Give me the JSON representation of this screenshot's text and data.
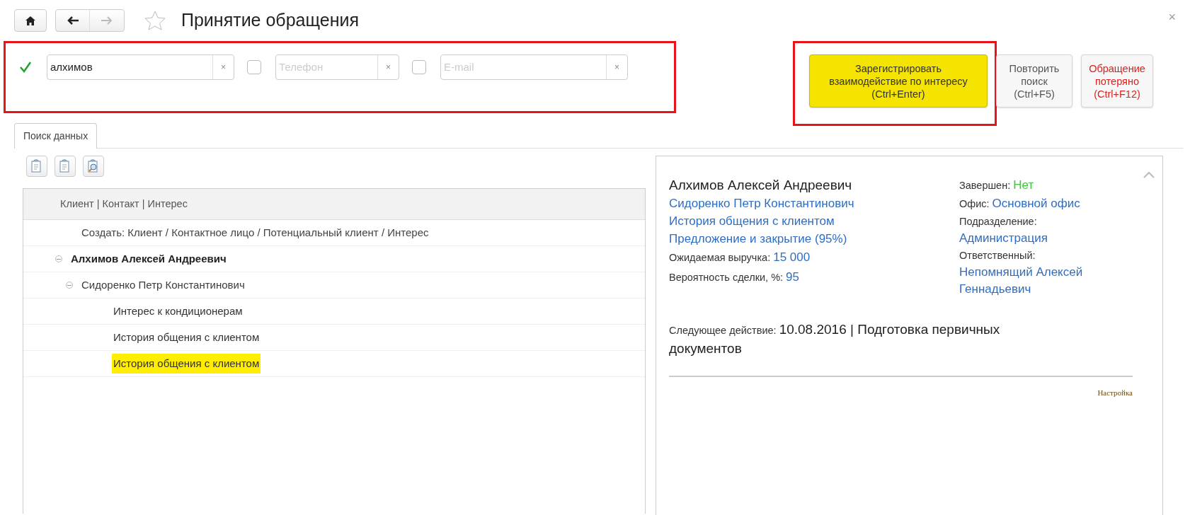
{
  "window": {
    "title": "Принятие обращения",
    "favorite": false
  },
  "filters": [
    {
      "checked": true,
      "value": "алхимов",
      "clear": "×"
    },
    {
      "checked": false,
      "placeholder": "Телефон",
      "clear": "×"
    },
    {
      "checked": false,
      "placeholder": "E-mail",
      "clear": "×"
    }
  ],
  "actions": [
    {
      "kind": "primary",
      "label": [
        "Зарегистрировать",
        "взаимодействие по интересу",
        "(Ctrl+Enter)"
      ]
    },
    {
      "kind": "default",
      "label": [
        "Повторить",
        "поиск",
        "(Ctrl+F5)"
      ]
    },
    {
      "kind": "danger",
      "label": [
        "Обращение",
        "потеряно",
        "(Ctrl+F12)"
      ]
    }
  ],
  "close": "×",
  "tabs": [
    {
      "label": "Поиск данных",
      "selected": true
    }
  ],
  "tree": {
    "header": "Клиент | Контакт | Интерес",
    "items": [
      {
        "kind": "action",
        "label": "Создать: Клиент / Контактное лицо / Потенциальный клиент / Интерес",
        "selected": false
      },
      {
        "kind": "client",
        "label": "Алхимов Алексей Андреевич",
        "selected": false,
        "expanded": true,
        "children": [
          {
            "kind": "contact",
            "label": "Сидоренко Петр Константинович",
            "selected": false,
            "expanded": true,
            "children": [
              {
                "kind": "interest",
                "label": "Интерес к кондиционерам",
                "selected": false
              },
              {
                "kind": "interest",
                "label": "История общения с клиентом",
                "selected": false
              },
              {
                "kind": "interest",
                "label": "История общения с клиентом",
                "selected": true
              }
            ]
          }
        ]
      }
    ]
  },
  "details": {
    "title": "Алхимов Алексей Андреевич",
    "links": [
      "Сидоренко Петр Константинович",
      "История общения с клиентом",
      "Предложение и закрытие (95%)"
    ],
    "fields": [
      {
        "label": "Ожидаемая выручка:",
        "value": "15 000"
      },
      {
        "label": "Вероятность сделки, %:",
        "value": "95"
      }
    ],
    "side_fields": [
      {
        "label": "Завершен:",
        "value": "Нет",
        "kind": "status",
        "inline": true
      },
      {
        "label": "Офис:",
        "value": "Основной офис",
        "kind": "link",
        "inline": true
      },
      {
        "label": "Подразделение:",
        "value": "Администрация",
        "kind": "link",
        "inline": false
      },
      {
        "label": "Ответственный:",
        "value": "Непомнящий Алексей Геннадьевич",
        "kind": "link",
        "inline": false
      }
    ],
    "next_action": {
      "label": "Следующее действие:",
      "value": "10.08.2016 | Подготовка первичных документов"
    },
    "settings_link": "Настройка"
  }
}
